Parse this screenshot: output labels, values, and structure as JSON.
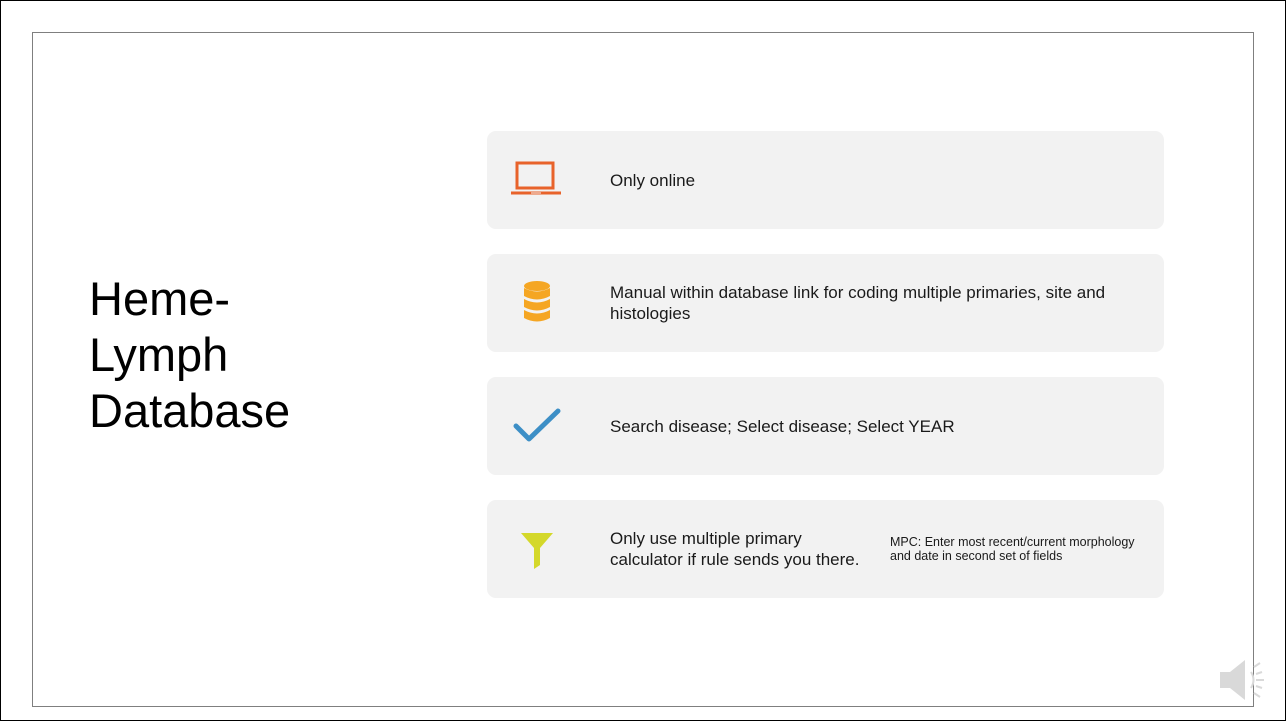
{
  "slide": {
    "title_lines": [
      "Heme-",
      "Lymph",
      "Database"
    ]
  },
  "cards": [
    {
      "icon": "laptop-icon",
      "text": "Only online",
      "icon_color": "#e8632b"
    },
    {
      "icon": "database-icon",
      "text": "Manual within database link for coding multiple primaries, site and histologies",
      "icon_color": "#f5a623"
    },
    {
      "icon": "checkmark-icon",
      "text": "Search disease; Select disease; Select YEAR",
      "icon_color": "#3d8fc6"
    },
    {
      "icon": "funnel-icon",
      "text": "Only use multiple primary calculator if rule sends you there.",
      "subtext": "MPC: Enter most recent/current morphology and date in second set of fields",
      "icon_color": "#d4d82a"
    }
  ],
  "audio": {
    "icon": "speaker-icon"
  },
  "colors": {
    "card_background": "#f2f2f2",
    "slide_border": "#7f7f7f"
  }
}
